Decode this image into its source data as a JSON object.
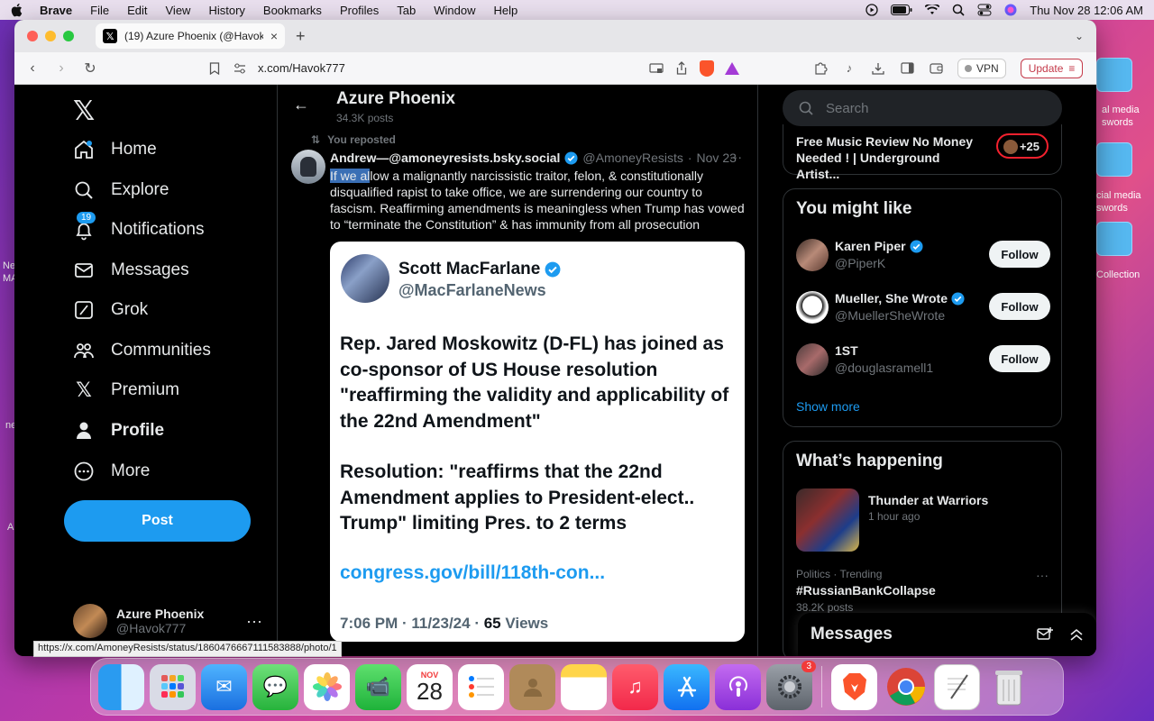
{
  "menubar": {
    "app": "Brave",
    "items": [
      "File",
      "Edit",
      "View",
      "History",
      "Bookmarks",
      "Profiles",
      "Tab",
      "Window",
      "Help"
    ],
    "datetime": "Thu Nov 28  12:06 AM"
  },
  "desktop": {
    "labels_right": [
      "al media",
      "swords",
      "cial media",
      "swords",
      "Collection"
    ],
    "labels_left": [
      "Ne",
      "MA",
      "ne",
      "A"
    ]
  },
  "browser": {
    "tab_title": "(19) Azure Phoenix (@Havok7",
    "url": "x.com/Havok777",
    "vpn_label": "VPN",
    "update_label": "Update",
    "status_url": "https://x.com/AmoneyResists/status/1860476667111583888/photo/1"
  },
  "nav": {
    "items": [
      {
        "label": "Home",
        "icon": "home-icon"
      },
      {
        "label": "Explore",
        "icon": "search-icon"
      },
      {
        "label": "Notifications",
        "icon": "bell-icon",
        "badge": "19"
      },
      {
        "label": "Messages",
        "icon": "mail-icon"
      },
      {
        "label": "Grok",
        "icon": "grok-icon"
      },
      {
        "label": "Communities",
        "icon": "people-icon"
      },
      {
        "label": "Premium",
        "icon": "x-icon"
      },
      {
        "label": "Profile",
        "icon": "person-icon"
      },
      {
        "label": "More",
        "icon": "more-circle-icon"
      }
    ],
    "post_label": "Post",
    "account": {
      "name": "Azure Phoenix",
      "handle": "@Havok777"
    }
  },
  "profile": {
    "name": "Azure Phoenix",
    "post_count": "34.3K posts"
  },
  "tweet": {
    "repost_label": "You reposted",
    "author": "Andrew—@amoneyresists.bsky.social",
    "handle": "@AmoneyResists",
    "date": "Nov 23",
    "text_selected": "If we al",
    "text_rest": "low a malignantly narcissistic traitor, felon, & constitutionally disqualified rapist to take office, we are surrendering our country to fascism. Reaffirming amendments is meaningless when Trump has vowed to “terminate the Constitution” & has immunity from all prosecution",
    "card": {
      "name": "Scott MacFarlane",
      "handle": "@MacFarlaneNews",
      "body1": "Rep. Jared Moskowitz (D-FL) has joined as co-sponsor of US House resolution \"reaffirming the validity and applicability of the 22nd Amendment\"",
      "body2": "Resolution: \"reaffirms that the 22nd Amendment applies to President-elect.. Trump\" limiting Pres. to 2 terms",
      "link": "congress.gov/bill/118th-con...",
      "time": "7:06 PM · 11/23/24 · ",
      "views_count": "65",
      "views_label": " Views"
    }
  },
  "right": {
    "search_placeholder": "Search",
    "promo_text": "Free Music Review No Money Needed ! | Underground Artist...",
    "promo_badge": "+25",
    "might_like_title": "You might like",
    "users": [
      {
        "name": "Karen Piper",
        "handle": "@PiperK",
        "follow": "Follow",
        "verified": true
      },
      {
        "name": "Mueller, She Wrote",
        "handle": "@MuellerSheWrote",
        "follow": "Follow",
        "verified": true
      },
      {
        "name": "1ST",
        "handle": "@douglasramell1",
        "follow": "Follow",
        "verified": false
      }
    ],
    "show_more": "Show more",
    "happening_title": "What’s happening",
    "trend1": {
      "title": "Thunder at Warriors",
      "sub": "1 hour ago"
    },
    "trend2": {
      "category": "Politics · Trending",
      "title": "#RussianBankCollapse",
      "posts": "38.2K posts"
    }
  },
  "messages_drawer": {
    "title": "Messages"
  },
  "dock": {
    "apps": [
      "Finder",
      "Launchpad",
      "Mail",
      "Messages",
      "Photos",
      "FaceTime",
      "Calendar",
      "Reminders",
      "Contacts",
      "Notes",
      "Music",
      "App Store",
      "Podcasts",
      "System Settings",
      "Brave",
      "Chrome",
      "TextEdit",
      "Trash"
    ],
    "calendar_month": "NOV",
    "calendar_day": "28",
    "settings_badge": "3"
  },
  "colors": {
    "accent": "#1d9bf0",
    "background": "#000000",
    "border": "#2f3336"
  }
}
